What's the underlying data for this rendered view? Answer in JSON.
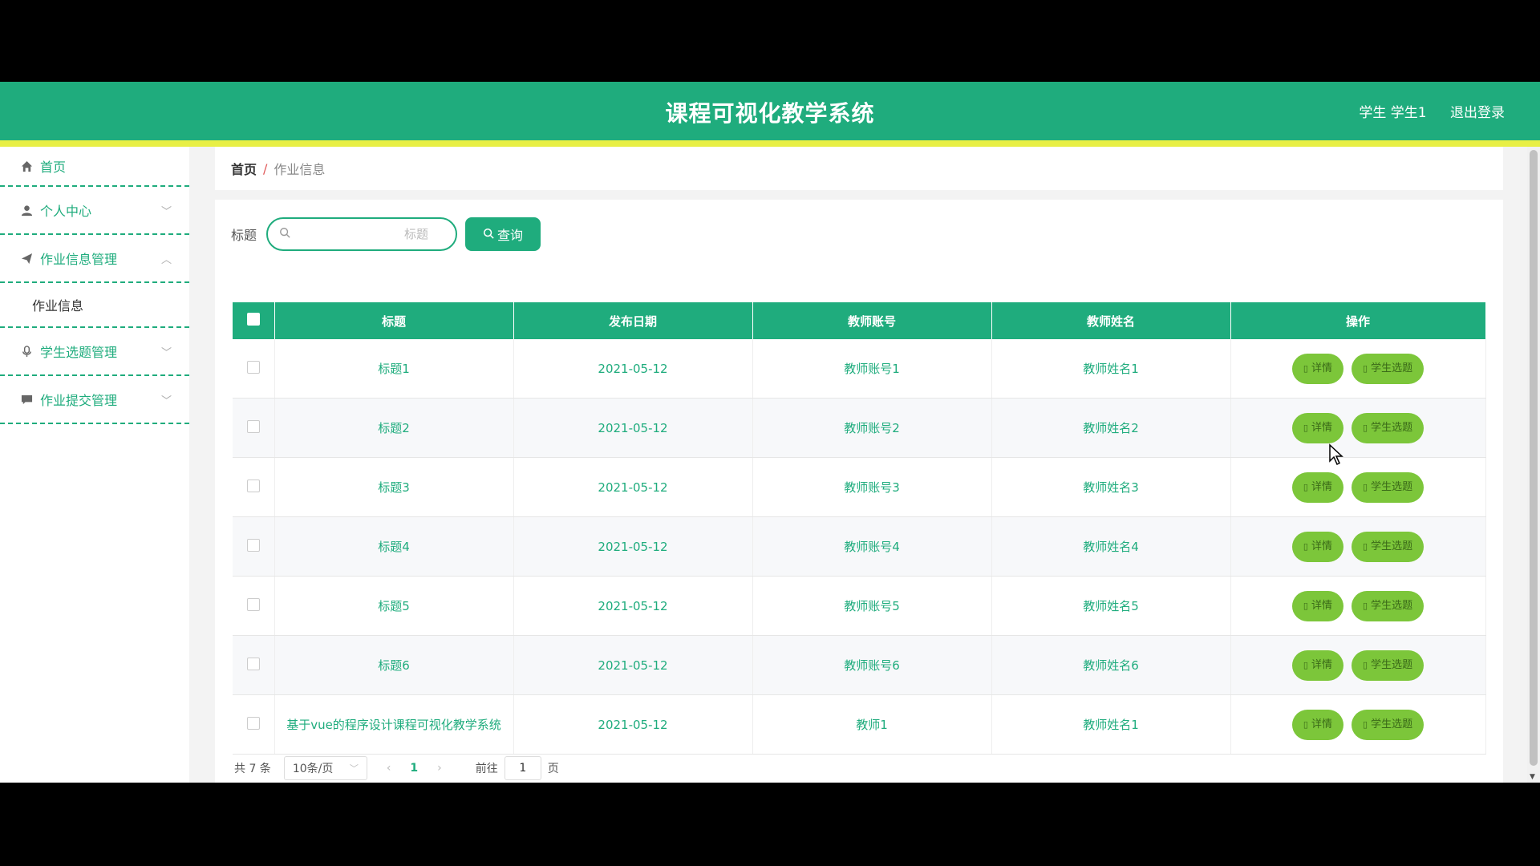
{
  "header": {
    "title": "课程可视化教学系统",
    "user": "学生 学生1",
    "logout": "退出登录"
  },
  "sidebar": {
    "home": {
      "label": "首页",
      "icon": "home-icon"
    },
    "personal": {
      "label": "个人中心",
      "icon": "user-icon"
    },
    "homework_mgmt": {
      "label": "作业信息管理",
      "icon": "paper-plane-icon"
    },
    "homework_info": {
      "label": "作业信息"
    },
    "topic_mgmt": {
      "label": "学生选题管理",
      "icon": "microphone-icon"
    },
    "submit_mgmt": {
      "label": "作业提交管理",
      "icon": "chat-icon"
    }
  },
  "breadcrumb": {
    "home": "首页",
    "separator": "/",
    "current": "作业信息"
  },
  "search": {
    "label": "标题",
    "placeholder": "标题",
    "button": "查询"
  },
  "table": {
    "headers": [
      "标题",
      "发布日期",
      "教师账号",
      "教师姓名",
      "操作"
    ],
    "rows": [
      {
        "title": "标题1",
        "date": "2021-05-12",
        "account": "教师账号1",
        "name": "教师姓名1"
      },
      {
        "title": "标题2",
        "date": "2021-05-12",
        "account": "教师账号2",
        "name": "教师姓名2"
      },
      {
        "title": "标题3",
        "date": "2021-05-12",
        "account": "教师账号3",
        "name": "教师姓名3"
      },
      {
        "title": "标题4",
        "date": "2021-05-12",
        "account": "教师账号4",
        "name": "教师姓名4"
      },
      {
        "title": "标题5",
        "date": "2021-05-12",
        "account": "教师账号5",
        "name": "教师姓名5"
      },
      {
        "title": "标题6",
        "date": "2021-05-12",
        "account": "教师账号6",
        "name": "教师姓名6"
      },
      {
        "title": "基于vue的程序设计课程可视化教学系统",
        "date": "2021-05-12",
        "account": "教师1",
        "name": "教师姓名1"
      }
    ],
    "actions": {
      "detail": "详情",
      "select": "学生选题"
    }
  },
  "pagination": {
    "total": "共 7 条",
    "page_size": "10条/页",
    "current_page": "1",
    "goto_label": "前往",
    "goto_value": "1",
    "page_unit": "页"
  },
  "colors": {
    "primary": "#1fac7d",
    "accent_bar": "#e8ef45",
    "action_button": "#7cc63a"
  }
}
